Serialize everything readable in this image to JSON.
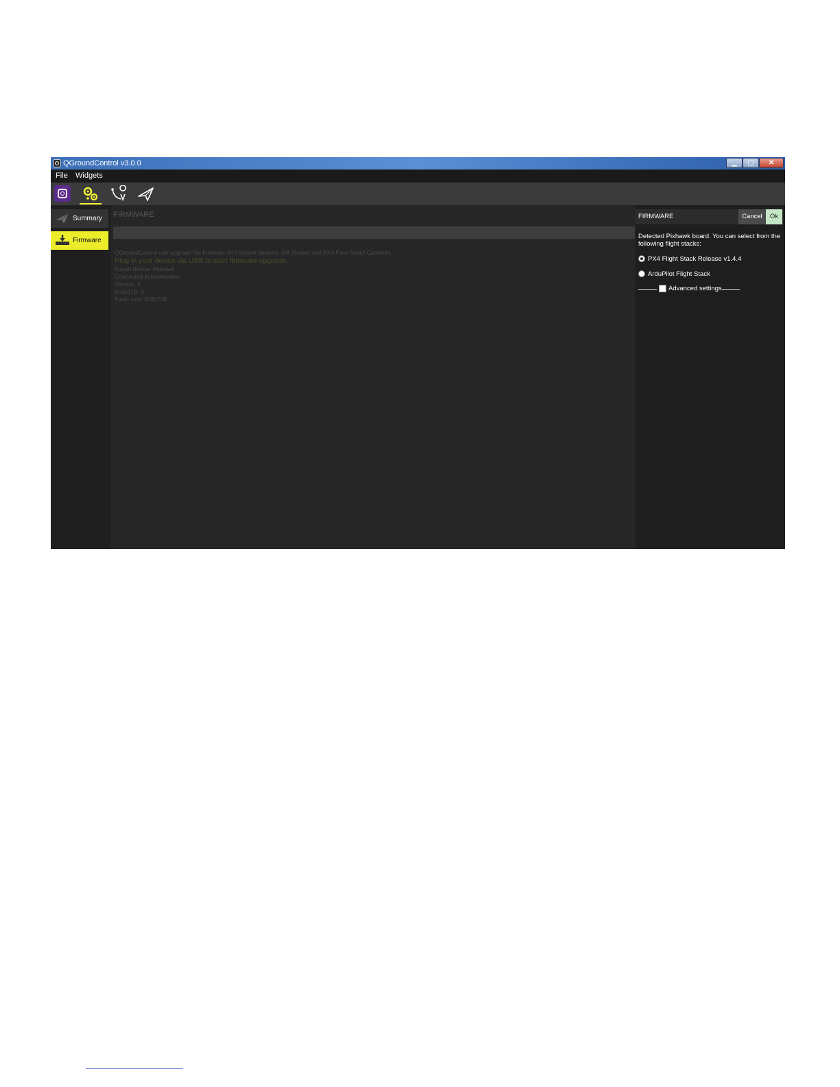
{
  "window": {
    "title": "QGroundControl v3.0.0",
    "controls": {
      "minimize": "▁",
      "maximize": "▢",
      "close": "✕"
    }
  },
  "menu": {
    "items": [
      "File",
      "Widgets"
    ]
  },
  "toolbar": {
    "icons": [
      "qgc-logo-icon",
      "vehicle-setup-icon",
      "plan-view-icon",
      "fly-view-icon"
    ],
    "active": "vehicle-setup-icon",
    "accent_color": "#f5f53a"
  },
  "sidebar": {
    "items": [
      {
        "label": "Summary",
        "icon": "paper-plane-icon"
      },
      {
        "label": "Firmware",
        "icon": "download-icon"
      }
    ],
    "active_color": "#ecec2b"
  },
  "main": {
    "heading": "FIRMWARE",
    "lines": [
      "QGroundControl can upgrade the firmware on Pixhawk devices, SiK Radios and PX4 Flow Smart Cameras.",
      "Plug in your device via USB to start firmware upgrade.",
      "Found device: Pixhawk",
      "Connected to bootloader:",
      "Version: 4",
      "Board ID: 9",
      "Flash size: 2080768"
    ]
  },
  "dialog": {
    "title": "FIRMWARE",
    "cancel_label": "Cancel",
    "ok_label": "Ok",
    "message": "Detected Pixhawk board. You can select from the following flight stacks:",
    "options": [
      {
        "label": "PX4 Flight Stack Release v1.4.4",
        "checked": true
      },
      {
        "label": "ArduPilot Flight Stack",
        "checked": false
      }
    ],
    "advanced_label": "Advanced settings",
    "advanced_checked": false
  }
}
